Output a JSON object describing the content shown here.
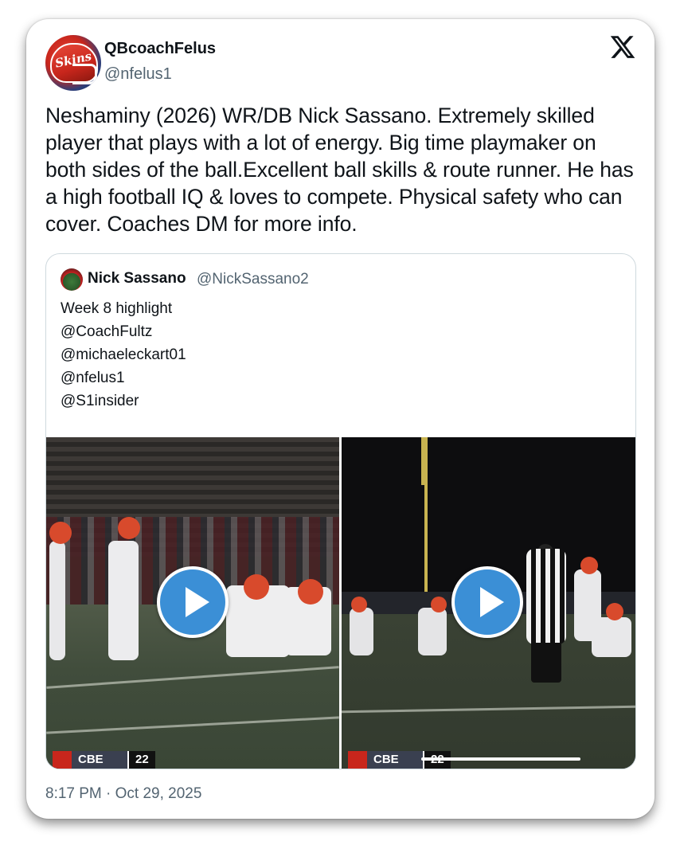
{
  "tweet": {
    "author_name": "QBcoachFelus",
    "author_handle": "@nfelus1",
    "avatar_icon": "helmet-logo-icon",
    "avatar_logo_text": "Skins",
    "text": "Neshaminy (2026) WR/DB Nick Sassano. Extremely skilled player that plays with a lot of energy. Big time playmaker on both sides of the ball.Excellent ball skills & route runner. He has a high football IQ & loves to compete. Physical safety who can cover. Coaches DM for more info.",
    "timestamp": "8:17 PM · Oct 29, 2025",
    "platform_icon": "x-logo-icon"
  },
  "quote": {
    "author_name": "Nick Sassano",
    "author_handle": "@NickSassano2",
    "lines": [
      "Week 8 highlight",
      "@CoachFultz",
      "@michaeleckart01",
      "@nfelus1",
      "@S1insider"
    ],
    "media": [
      {
        "type": "video",
        "play_icon": "play-icon",
        "scorebug_team": "CBE",
        "scorebug_score": "22"
      },
      {
        "type": "video",
        "play_icon": "play-icon",
        "scorebug_team": "CBE",
        "scorebug_score": "22"
      }
    ]
  },
  "colors": {
    "text_primary": "#0f1419",
    "text_secondary": "#536471",
    "border": "#cfd9de",
    "play_button": "#3b8fd6"
  }
}
